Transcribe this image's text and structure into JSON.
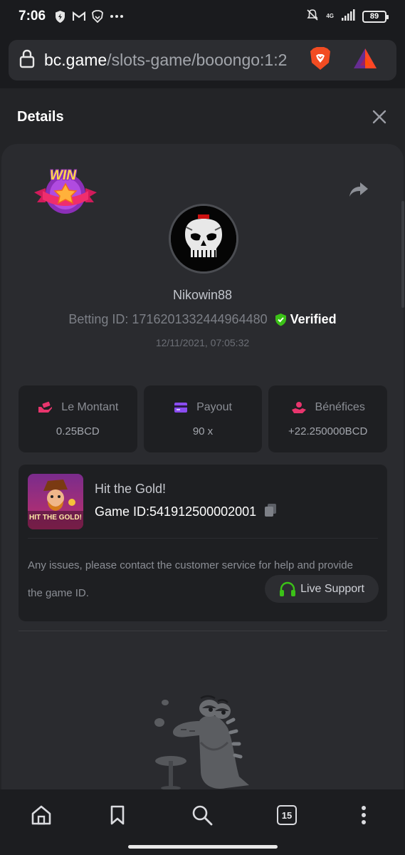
{
  "status": {
    "time": "7:06",
    "network": "4G",
    "battery": "89"
  },
  "browser": {
    "url_domain": "bc.game",
    "url_path": "/slots-game/booongo:1:2",
    "tab_count": "15"
  },
  "modal": {
    "title": "Details"
  },
  "badge": {
    "text": "WIN"
  },
  "bet": {
    "username": "Nikowin88",
    "betting_id_label": "Betting ID:",
    "betting_id": "1716201332444964480",
    "verified_label": "Verified",
    "date": "12/11/2021, 07:05:32"
  },
  "stats": [
    {
      "label": "Le Montant",
      "value": "0.25BCD",
      "icon": "money-hand-icon",
      "color": "#e8356d"
    },
    {
      "label": "Payout",
      "value": "90 x",
      "icon": "card-icon",
      "color": "#8a4cf0"
    },
    {
      "label": "Bénéfices",
      "value": "+22.250000BCD",
      "icon": "profit-hand-icon",
      "color": "#e8356d"
    }
  ],
  "game": {
    "name": "Hit the Gold!",
    "id_label": "Game ID:",
    "id": "541912500002001",
    "thumb_title": "HIT THE GOLD!"
  },
  "support": {
    "text": "Any issues, please contact the customer service for help and provide the game ID.",
    "button_label": "Live Support"
  },
  "colors": {
    "accent_green": "#3bc117",
    "background": "#232427",
    "card": "#2a2b2f"
  }
}
